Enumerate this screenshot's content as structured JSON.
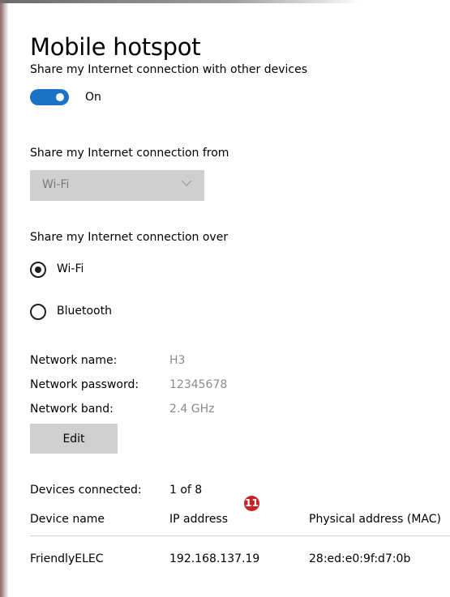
{
  "page": {
    "title": "Mobile hotspot"
  },
  "share": {
    "label": "Share my Internet connection with other devices",
    "toggle_state": "On"
  },
  "share_from": {
    "label": "Share my Internet connection from",
    "selected": "Wi-Fi"
  },
  "share_over": {
    "label": "Share my Internet connection over",
    "options": [
      {
        "label": "Wi-Fi",
        "selected": true
      },
      {
        "label": "Bluetooth",
        "selected": false
      }
    ]
  },
  "network": {
    "name_label": "Network name:",
    "name_value": "H3",
    "password_label": "Network password:",
    "password_value": "12345678",
    "band_label": "Network band:",
    "band_value": "2.4 GHz",
    "edit_label": "Edit"
  },
  "devices": {
    "connected_label": "Devices connected:",
    "connected_value": "1 of 8",
    "columns": [
      "Device name",
      "IP address",
      "Physical address (MAC)"
    ],
    "rows": [
      {
        "name": "FriendlyELEC",
        "ip": "192.168.137.19",
        "mac": "28:ed:e0:9f:d7:0b"
      }
    ]
  },
  "annotation": {
    "badge": "11"
  },
  "colors": {
    "accent": "#1a73c6",
    "badge": "#c62424"
  },
  "icons": {
    "dropdown": "chevron-down-icon"
  }
}
